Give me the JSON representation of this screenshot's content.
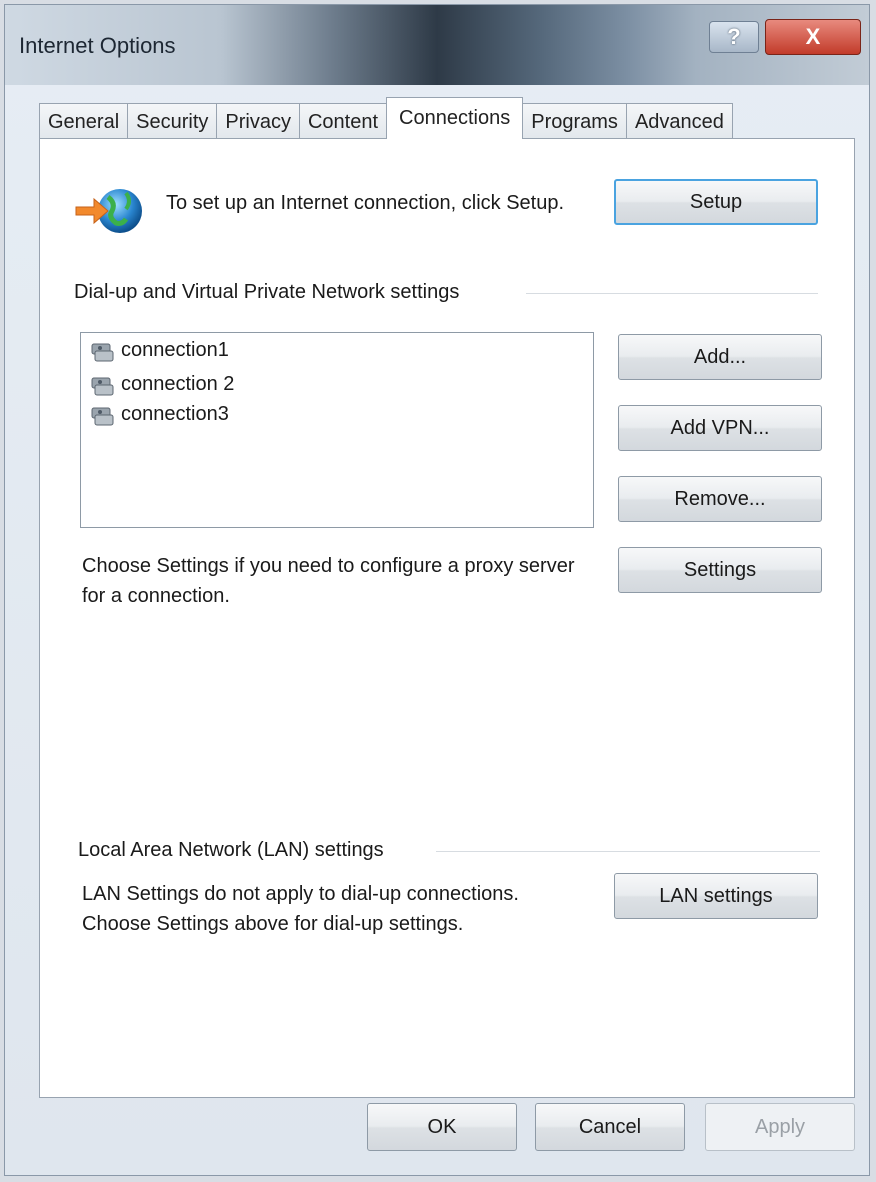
{
  "window": {
    "title": "Internet Options",
    "help_label": "?",
    "close_label": "X"
  },
  "tabs": [
    {
      "label": "General"
    },
    {
      "label": "Security"
    },
    {
      "label": "Privacy"
    },
    {
      "label": "Content"
    },
    {
      "label": "Connections",
      "active": true
    },
    {
      "label": "Programs"
    },
    {
      "label": "Advanced"
    }
  ],
  "setup": {
    "text": "To set up an Internet connection, click Setup.",
    "button": "Setup"
  },
  "dialup": {
    "heading": "Dial-up and Virtual Private Network settings",
    "connections": [
      "connection1",
      "connection 2",
      "connection3"
    ],
    "add_button": "Add...",
    "add_vpn_button": "Add VPN...",
    "remove_button": "Remove...",
    "proxy_text": "Choose Settings if you need to configure a proxy server for a connection.",
    "settings_button": "Settings"
  },
  "lan": {
    "heading": "Local Area Network (LAN) settings",
    "text": "LAN Settings do not apply to dial-up connections. Choose Settings above for dial-up settings.",
    "button": "LAN settings"
  },
  "footer": {
    "ok": "OK",
    "cancel": "Cancel",
    "apply": "Apply"
  },
  "colors": {
    "focus_border": "#4aa3e0",
    "close_red": "#c23b2a"
  }
}
